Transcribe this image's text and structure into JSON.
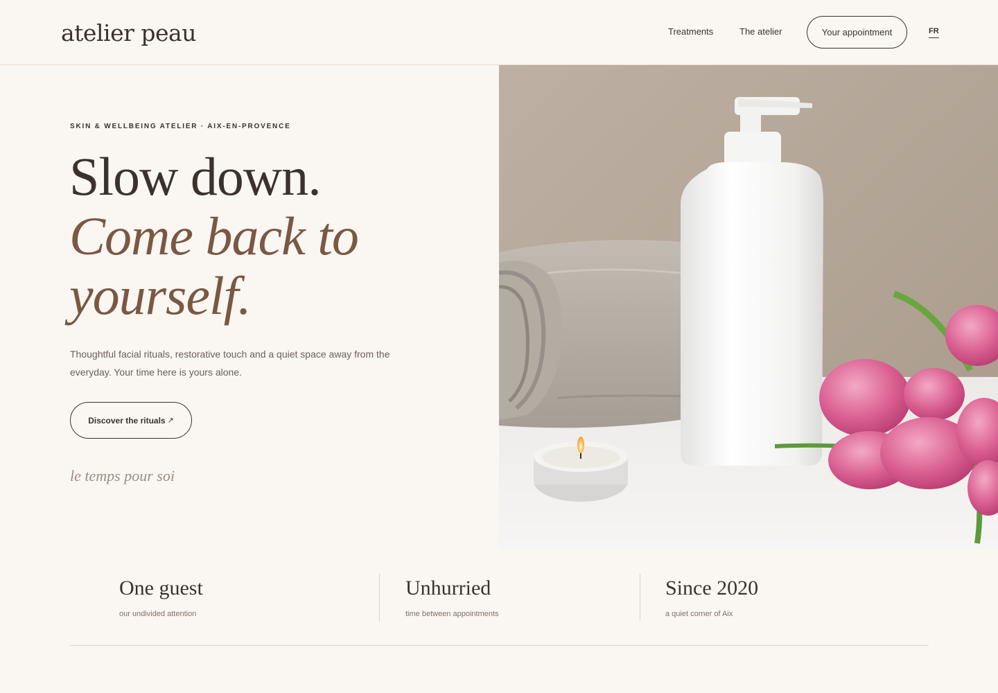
{
  "brand": {
    "logo": "atelier peau"
  },
  "nav": {
    "links": [
      "Treatments",
      "The atelier"
    ],
    "appointment_label": "Your appointment",
    "language": "FR"
  },
  "hero": {
    "eyebrow": "SKIN & WELLBEING ATELIER · AIX-EN-PROVENCE",
    "headline_line1": "Slow down.",
    "headline_line2": "Come back to yourself.",
    "intro": "Thoughtful facial rituals, restorative touch and a quiet space away from the everyday. Your time here is yours alone.",
    "cta_label": "Discover the rituals",
    "cta_icon": "arrow-up-right-icon",
    "tagline": "le temps pour soi"
  },
  "stats": [
    {
      "title": "One guest",
      "subtitle": "our undivided attention"
    },
    {
      "title": "Unhurried",
      "subtitle": "time between appointments"
    },
    {
      "title": "Since 2020",
      "subtitle": "a quiet corner of Aix"
    }
  ],
  "colors": {
    "background": "#faf6f2",
    "text": "#3b322c",
    "accent": "#7a5843",
    "muted": "#9a8e84",
    "tulip": "#d85a8c"
  }
}
